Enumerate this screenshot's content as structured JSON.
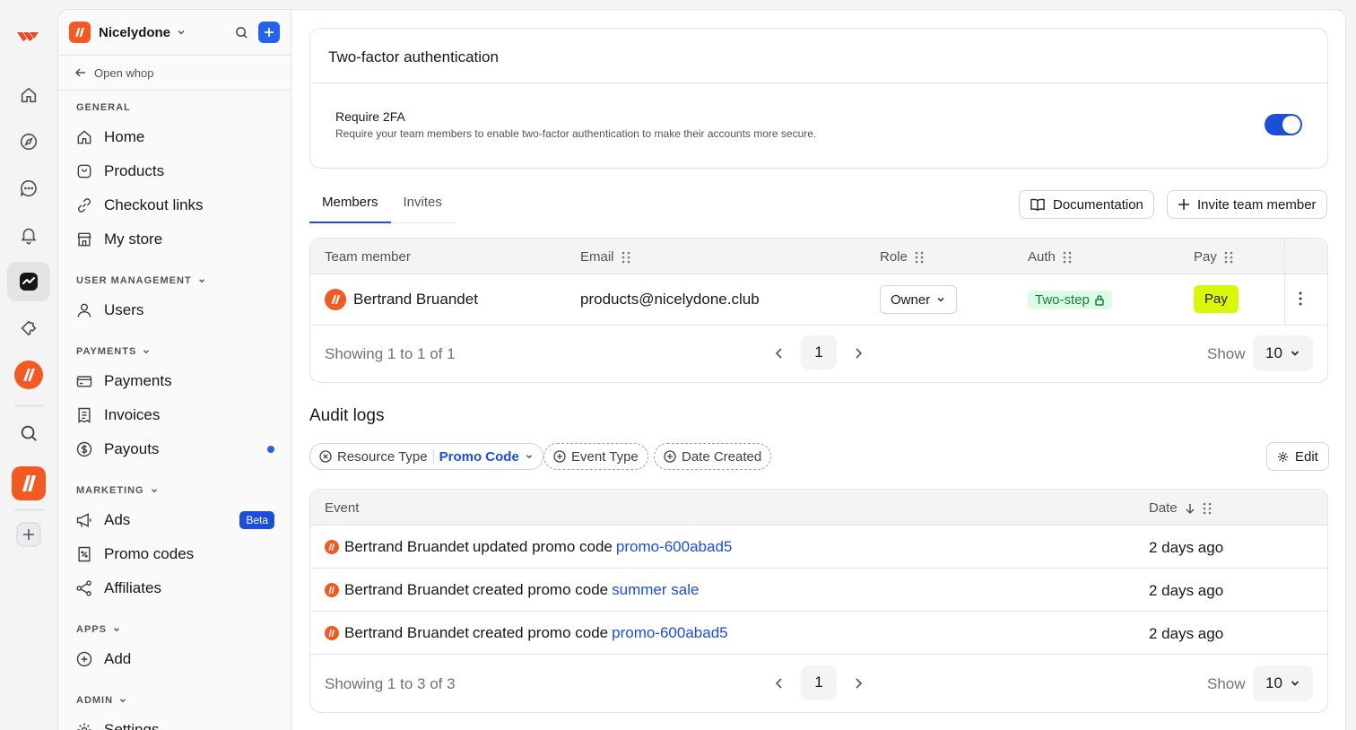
{
  "rail": {
    "items": [
      "home-icon",
      "compass-icon",
      "chat-icon",
      "bell-icon",
      "dashboard-icon",
      "puzzle-icon",
      "whop-logo-icon",
      "search-icon",
      "nicelydone-logo-icon",
      "plus-icon"
    ]
  },
  "sidebar": {
    "brand_name": "Nicelydone",
    "open_whop": "Open whop",
    "sections": {
      "general": "GENERAL",
      "user_management": "USER MANAGEMENT",
      "payments": "PAYMENTS",
      "marketing": "MARKETING",
      "apps": "APPS",
      "admin": "ADMIN"
    },
    "items": {
      "home": "Home",
      "products": "Products",
      "checkout_links": "Checkout links",
      "my_store": "My store",
      "users": "Users",
      "payments": "Payments",
      "invoices": "Invoices",
      "payouts": "Payouts",
      "ads": "Ads",
      "promo_codes": "Promo codes",
      "affiliates": "Affiliates",
      "add": "Add",
      "settings": "Settings"
    },
    "ads_badge": "Beta"
  },
  "tfa": {
    "title": "Two-factor authentication",
    "label": "Require 2FA",
    "description": "Require your team members to enable two-factor authentication to make their accounts more secure.",
    "enabled": true
  },
  "tabs": [
    "Members",
    "Invites"
  ],
  "actions": {
    "documentation": "Documentation",
    "invite": "Invite team member"
  },
  "members": {
    "headers": {
      "member": "Team member",
      "email": "Email",
      "role": "Role",
      "auth": "Auth",
      "pay": "Pay"
    },
    "rows": [
      {
        "name": "Bertrand Bruandet",
        "email": "products@nicelydone.club",
        "role": "Owner",
        "auth": "Two-step",
        "pay": "Pay"
      }
    ],
    "footer": "Showing 1 to 1 of 1",
    "page": "1",
    "show_label": "Show",
    "show_value": "10"
  },
  "audit": {
    "title": "Audit logs",
    "filters": {
      "resource_label": "Resource Type",
      "resource_value": "Promo Code",
      "event_type": "Event Type",
      "date_created": "Date Created"
    },
    "edit": "Edit",
    "headers": {
      "event": "Event",
      "date": "Date"
    },
    "rows": [
      {
        "actor": "Bertrand Bruandet",
        "action": "updated promo code",
        "target": "promo-600abad5",
        "date": "2 days ago"
      },
      {
        "actor": "Bertrand Bruandet",
        "action": "created promo code",
        "target": "summer sale",
        "date": "2 days ago"
      },
      {
        "actor": "Bertrand Bruandet",
        "action": "created promo code",
        "target": "promo-600abad5",
        "date": "2 days ago"
      }
    ],
    "footer": "Showing 1 to 3 of 3",
    "page": "1",
    "show_label": "Show",
    "show_value": "10"
  },
  "colors": {
    "accent": "#1d4ed8",
    "brand": "#f15a22",
    "pay": "#d9f70a",
    "auth_bg": "#dcfce7",
    "auth_fg": "#15803d"
  }
}
